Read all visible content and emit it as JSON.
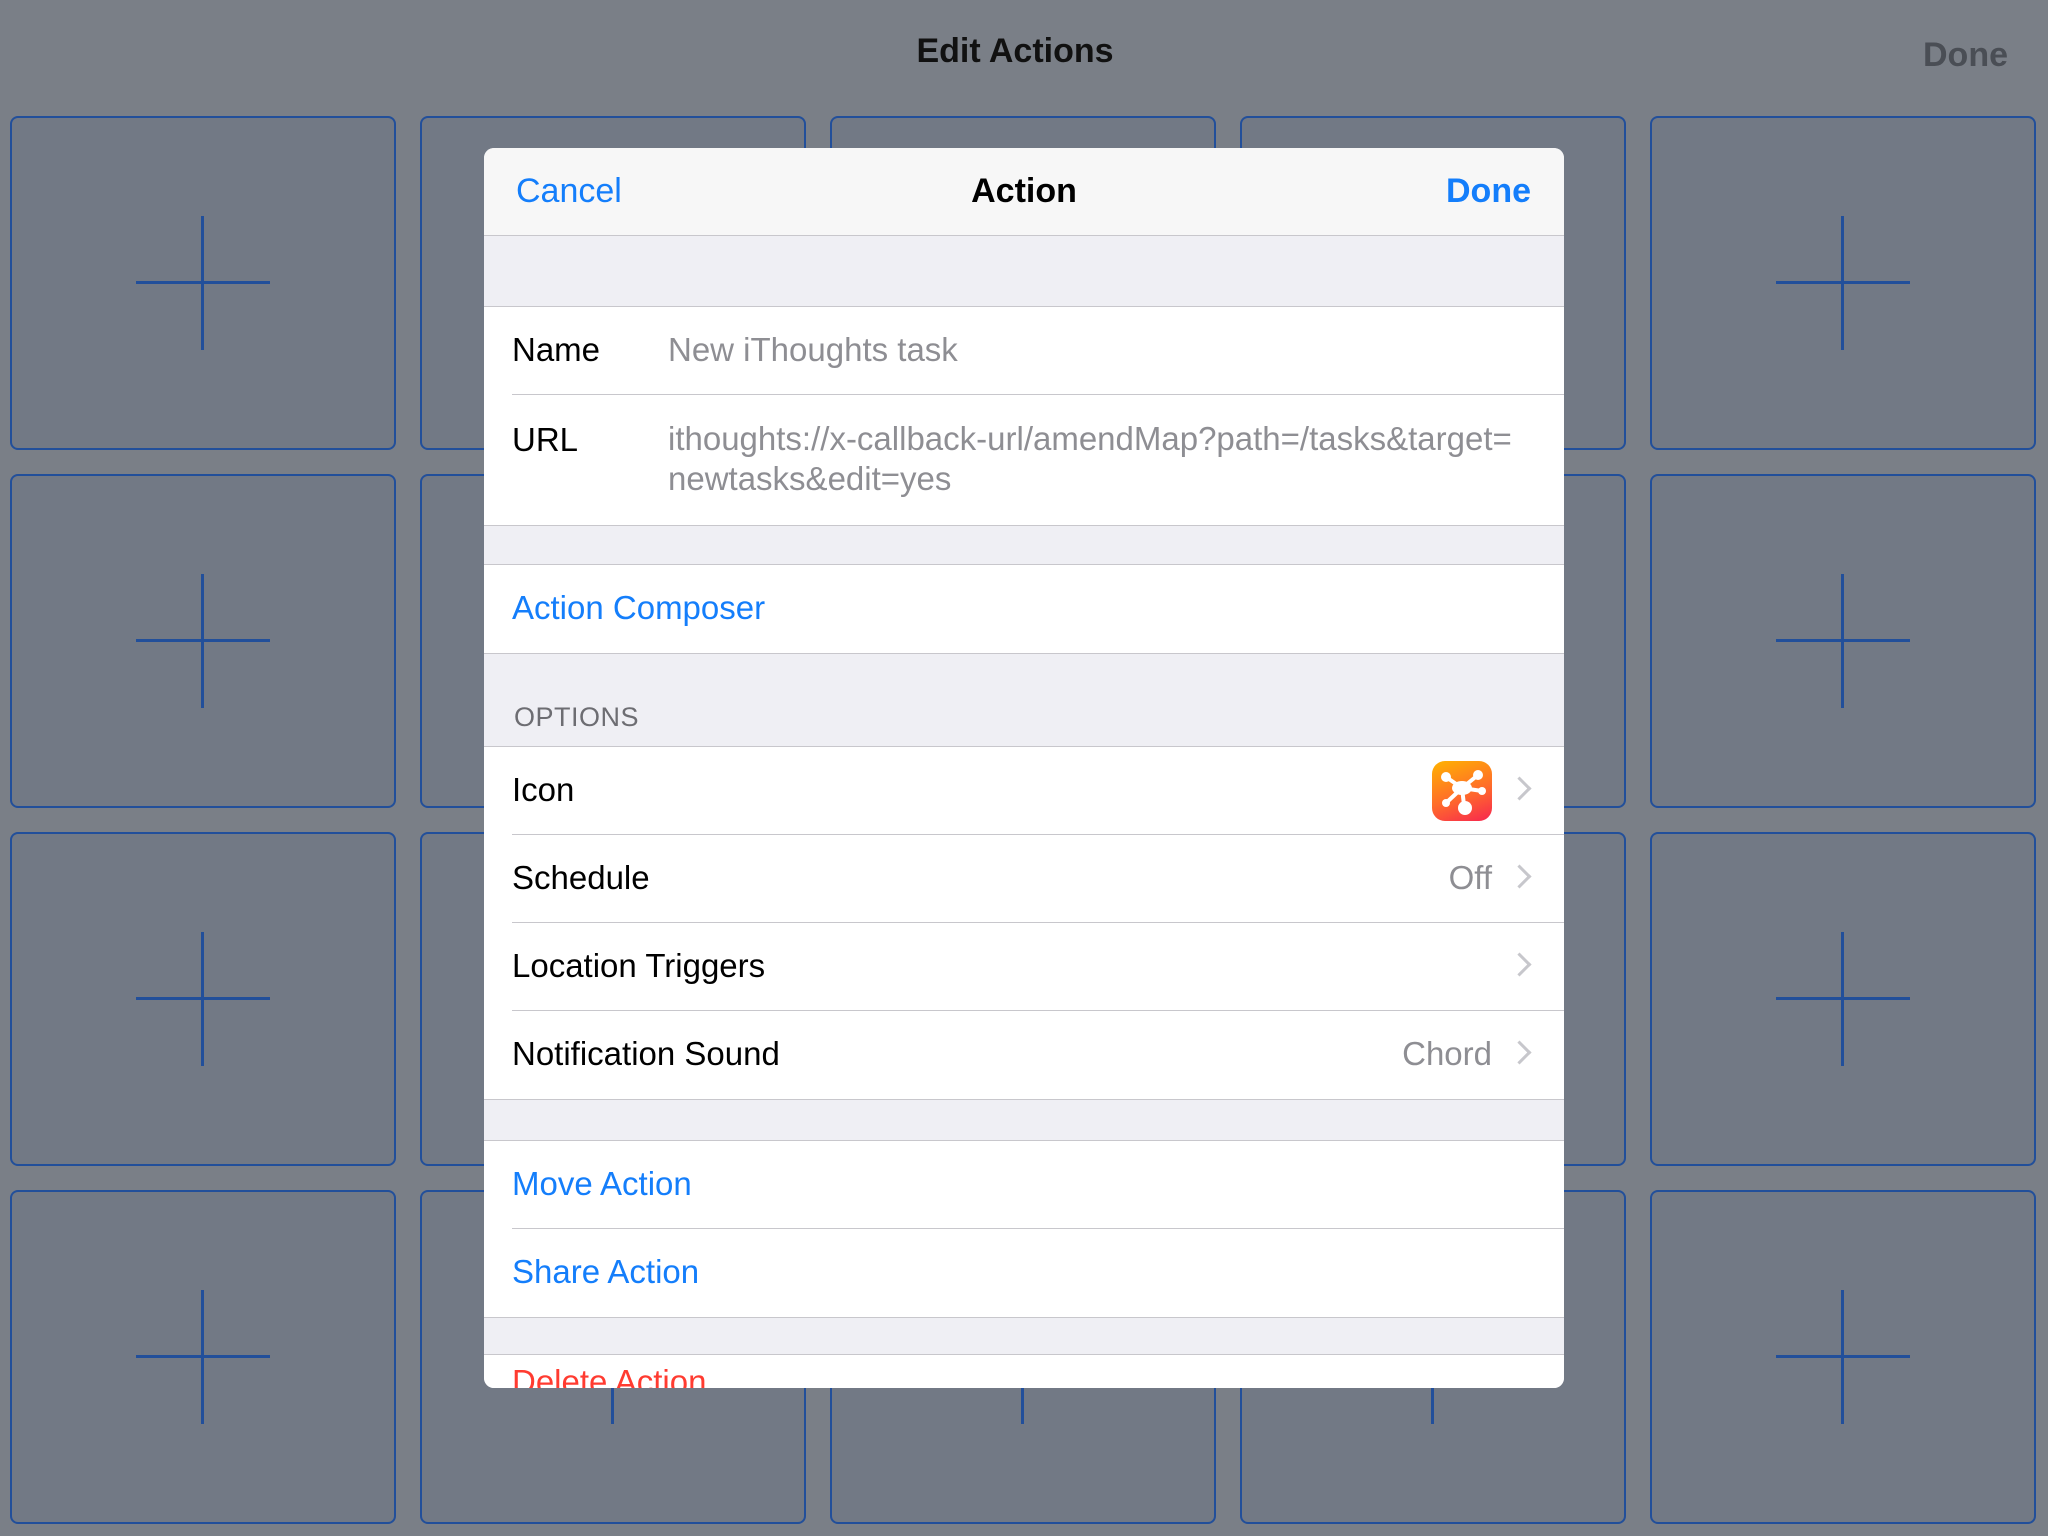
{
  "background": {
    "title": "Edit Actions",
    "done_label": "Done",
    "grid_rows": 4,
    "grid_cols": 5
  },
  "modal": {
    "nav": {
      "cancel_label": "Cancel",
      "title": "Action",
      "done_label": "Done"
    },
    "fields": {
      "name_label": "Name",
      "name_value": "New iThoughts task",
      "url_label": "URL",
      "url_value": "ithoughts://x-callback-url/amendMap?path=/tasks&target=newtasks&edit=yes"
    },
    "action_composer_label": "Action Composer",
    "options": {
      "header": "OPTIONS",
      "icon_label": "Icon",
      "icon_name": "ithoughts-app-icon",
      "schedule_label": "Schedule",
      "schedule_value": "Off",
      "location_label": "Location Triggers",
      "sound_label": "Notification Sound",
      "sound_value": "Chord"
    },
    "manage": {
      "move_label": "Move Action",
      "share_label": "Share Action"
    },
    "delete_label": "Delete Action"
  },
  "colors": {
    "accent": "#147efb",
    "destructive": "#ff3b30",
    "grid_line": "#224f9a",
    "overlay_bg": "#7a7f87"
  }
}
